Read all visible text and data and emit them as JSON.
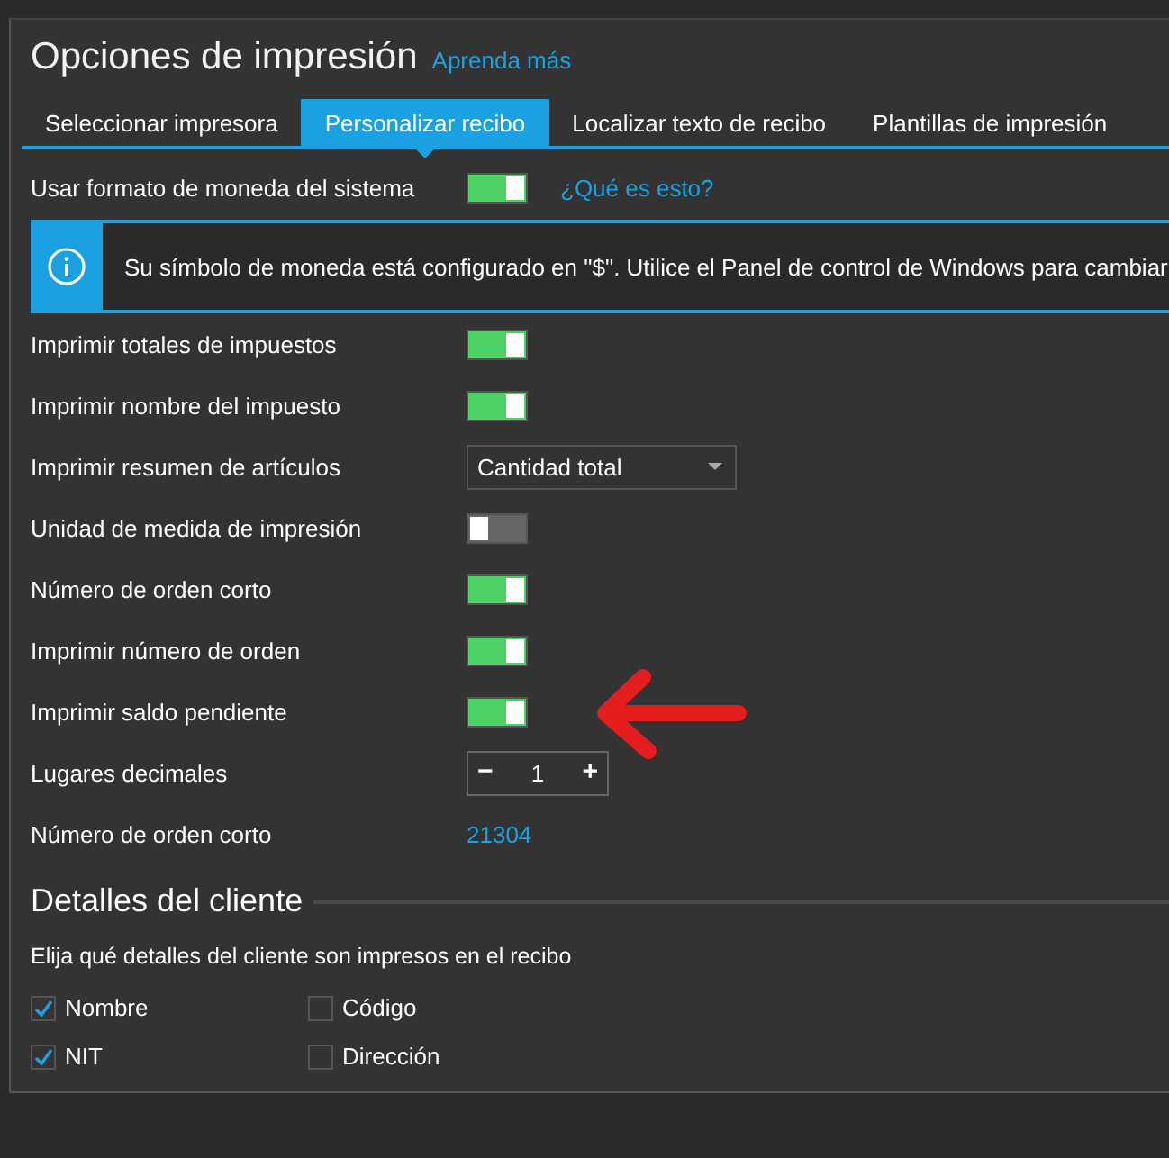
{
  "title": "Opciones de impresión",
  "learn_more": "Aprenda más",
  "tabs": [
    {
      "label": "Seleccionar impresora",
      "selected": false
    },
    {
      "label": "Personalizar recibo",
      "selected": true
    },
    {
      "label": "Localizar texto de recibo",
      "selected": false
    },
    {
      "label": "Plantillas de impresión",
      "selected": false
    }
  ],
  "currency_row": {
    "label": "Usar formato de moneda del sistema",
    "on": true,
    "link": "¿Qué es esto?"
  },
  "info_banner": "Su símbolo de moneda está configurado en \"$\". Utilice el Panel de control de Windows para cambiar",
  "settings": [
    {
      "kind": "toggle",
      "label": "Imprimir totales de impuestos",
      "on": true
    },
    {
      "kind": "toggle",
      "label": "Imprimir nombre del impuesto",
      "on": true
    },
    {
      "kind": "dropdown",
      "label": "Imprimir resumen de artículos",
      "value": "Cantidad total"
    },
    {
      "kind": "toggle",
      "label": "Unidad de medida de impresión",
      "on": false
    },
    {
      "kind": "toggle",
      "label": "Número de orden corto",
      "on": true
    },
    {
      "kind": "toggle",
      "label": "Imprimir número de orden",
      "on": true
    },
    {
      "kind": "toggle",
      "label": "Imprimir saldo pendiente",
      "on": true,
      "annotated": true
    },
    {
      "kind": "stepper",
      "label": "Lugares decimales",
      "value": "1",
      "minus": "−",
      "plus": "+"
    },
    {
      "kind": "value",
      "label": "Número de orden corto",
      "value": "21304"
    }
  ],
  "customer_section": {
    "heading": "Detalles del cliente",
    "description": "Elija qué detalles del cliente son impresos en el recibo",
    "options": [
      {
        "label": "Nombre",
        "checked": true
      },
      {
        "label": "Código",
        "checked": false
      },
      {
        "label": "NIT",
        "checked": true
      },
      {
        "label": "Dirección",
        "checked": false
      }
    ]
  }
}
